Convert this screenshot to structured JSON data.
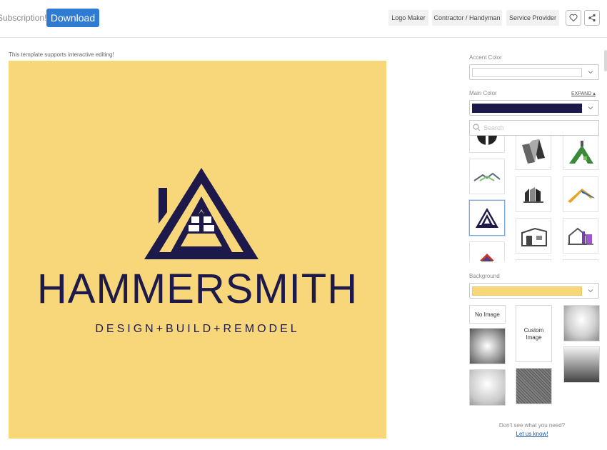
{
  "header": {
    "subscription_text": "Subscription!",
    "download_label": "Download",
    "tags": [
      "Logo Maker",
      "Contractor / Handyman",
      "Service Provider"
    ],
    "favorite_icon": "heart-icon",
    "share_icon": "share-icon"
  },
  "editor": {
    "note": "This template supports interactive editing!",
    "logo": {
      "brand_name": "HAMMERSMITH",
      "tagline": "DESIGN+BUILD+REMODEL",
      "background_color": "#f7d77a",
      "main_color": "#1d1a4b"
    }
  },
  "panel": {
    "accent_label": "Accent Color",
    "accent_color": "#ffffff",
    "main_label": "Main Color",
    "expand_label": "EXPAND",
    "main_color": "#1d1a4b",
    "search_placeholder": "Search",
    "icon_options": [
      "bw-circle-icon",
      "steel-beam-icon",
      "green-roof-icon",
      "roof-line-icon",
      "gray-buildings-icon",
      "blue-orange-roof-icon",
      "triangle-house-icon",
      "modern-house-icon",
      "purple-house-icon",
      "small-house-icon"
    ],
    "background_label": "Background",
    "background_color": "#f7d77a",
    "no_image_label": "No Image",
    "custom_image_label": "Custom Image",
    "help_text": "Don't see what you need?",
    "help_link": "Let us know!"
  }
}
